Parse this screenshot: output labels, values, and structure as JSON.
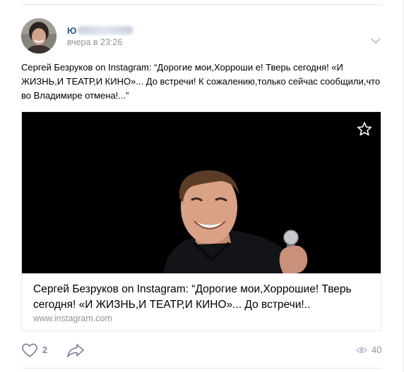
{
  "post": {
    "author_initial": "Ю",
    "time": "вчера в 23:26",
    "text": "Сергей Безруков on Instagram: “Дорогие мои,Хорроши е! Тверь сегодня! «И ЖИЗНЬ,И ТЕАТР,И КИНО»... До встречи! К сожалению,только сейчас сообщили,что во Владимире отмена!...”"
  },
  "link": {
    "title": "Сергей Безруков on Instagram: “Дорогие мои,Хоррошие! Тверь сегодня! «И ЖИЗНЬ,И ТЕАТР,И КИНО»... До встречи!..",
    "url": "www.instagram.com"
  },
  "actions": {
    "likes": "2",
    "views": "40"
  },
  "icons": {
    "options": "chevron-down-icon",
    "bookmark": "star-icon",
    "like": "heart-icon",
    "share": "share-arrow-icon",
    "views": "eye-icon"
  },
  "colors": {
    "link_blue": "#2a5885",
    "meta_gray": "#939393",
    "icon_gray": "#828a99"
  }
}
